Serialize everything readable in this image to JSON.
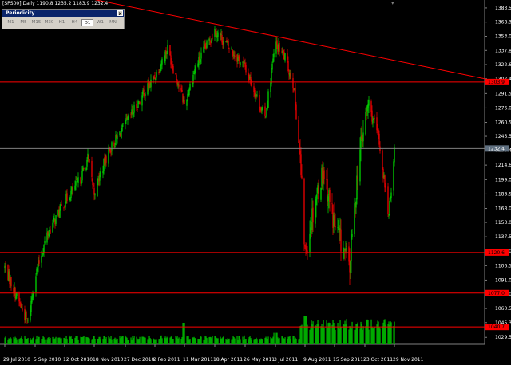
{
  "title": "[SPS00],Daily  1190.8 1235.2 1183.9 1232.4",
  "periodicity": {
    "header": "Periodicity",
    "close": "x",
    "buttons": [
      "M1",
      "M5",
      "M15",
      "M30",
      "H1",
      "H4",
      "D1",
      "W1",
      "MN"
    ],
    "active": "D1"
  },
  "colors": {
    "background": "#000000",
    "bull": "#00c800",
    "bear": "#e00000",
    "level_line": "#ff0000",
    "trend_line": "#ff0000",
    "price_line": "#808080",
    "axis_text": "#ffffff",
    "volume": "#00aa00"
  },
  "chart_data": {
    "type": "candlestick",
    "y_axis_ticks": [
      1383.5,
      1368.3,
      1353.0,
      1337.8,
      1322.6,
      1307.4,
      1291.5,
      1276.0,
      1260.5,
      1245.5,
      1230.4,
      1214.6,
      1199.0,
      1183.5,
      1168.0,
      1153.0,
      1137.5,
      1122.0,
      1106.5,
      1091.0,
      1076.0,
      1060.5,
      1045.3,
      1029.5
    ],
    "ylim": [
      1022.0,
      1392.0
    ],
    "x_axis_ticks": [
      "29 Jul 2010",
      "5 Sep 2010",
      "12 Oct 2010",
      "18 Nov 2010",
      "27 Dec 2010",
      "2 Feb 2011",
      "11 Mar 2011",
      "18 Apr 2011",
      "26 May 2011",
      "3 Jul 2011",
      "9 Aug 2011",
      "15 Sep 2011",
      "23 Oct 2011",
      "29 Nov 2011"
    ],
    "current_price": 1232.4,
    "current_price_label": "1232.4",
    "horizontal_levels": [
      {
        "price": 1303.9,
        "label": "1303.9"
      },
      {
        "price": 1120.6,
        "label": "1120.6"
      },
      {
        "price": 1077.0,
        "label": "1077.0"
      },
      {
        "price": 1040.7,
        "label": "1040.7"
      }
    ],
    "trend_line": {
      "from": {
        "date": "29 Jul 2010",
        "price": 1412.0
      },
      "to": {
        "date": "29 Nov 2011",
        "price": 1307.4
      }
    },
    "price_anchors": [
      [
        "29 Jul 2010",
        1105
      ],
      [
        "12 Aug 2010",
        1075
      ],
      [
        "27 Aug 2010",
        1045
      ],
      [
        "5 Sep 2010",
        1095
      ],
      [
        "20 Sep 2010",
        1140
      ],
      [
        "12 Oct 2010",
        1175
      ],
      [
        "1 Nov 2010",
        1200
      ],
      [
        "10 Nov 2010",
        1222
      ],
      [
        "18 Nov 2010",
        1185
      ],
      [
        "5 Dec 2010",
        1228
      ],
      [
        "27 Dec 2010",
        1258
      ],
      [
        "18 Jan 2011",
        1290
      ],
      [
        "2 Feb 2011",
        1310
      ],
      [
        "18 Feb 2011",
        1340
      ],
      [
        "11 Mar 2011",
        1280
      ],
      [
        "25 Mar 2011",
        1320
      ],
      [
        "18 Apr 2011",
        1360
      ],
      [
        "2 May 2011",
        1345
      ],
      [
        "26 May 2011",
        1320
      ],
      [
        "20 Jun 2011",
        1265
      ],
      [
        "3 Jul 2011",
        1345
      ],
      [
        "15 Jul 2011",
        1330
      ],
      [
        "26 Jul 2011",
        1300
      ],
      [
        "3 Aug 2011",
        1220
      ],
      [
        "9 Aug 2011",
        1120
      ],
      [
        "20 Aug 2011",
        1170
      ],
      [
        "1 Sep 2011",
        1210
      ],
      [
        "15 Sep 2011",
        1150
      ],
      [
        "4 Oct 2011",
        1105
      ],
      [
        "15 Oct 2011",
        1220
      ],
      [
        "27 Oct 2011",
        1280
      ],
      [
        "9 Nov 2011",
        1245
      ],
      [
        "22 Nov 2011",
        1160
      ],
      [
        "29 Nov 2011",
        1232
      ]
    ],
    "volume": {
      "baseline": "bottom",
      "typical_height_fraction": 0.35,
      "spikes": [
        [
          "9 Aug 2011",
          1.0
        ],
        [
          "11 Mar 2011",
          0.75
        ],
        [
          "3 Jul 2011",
          0.4
        ]
      ]
    }
  }
}
